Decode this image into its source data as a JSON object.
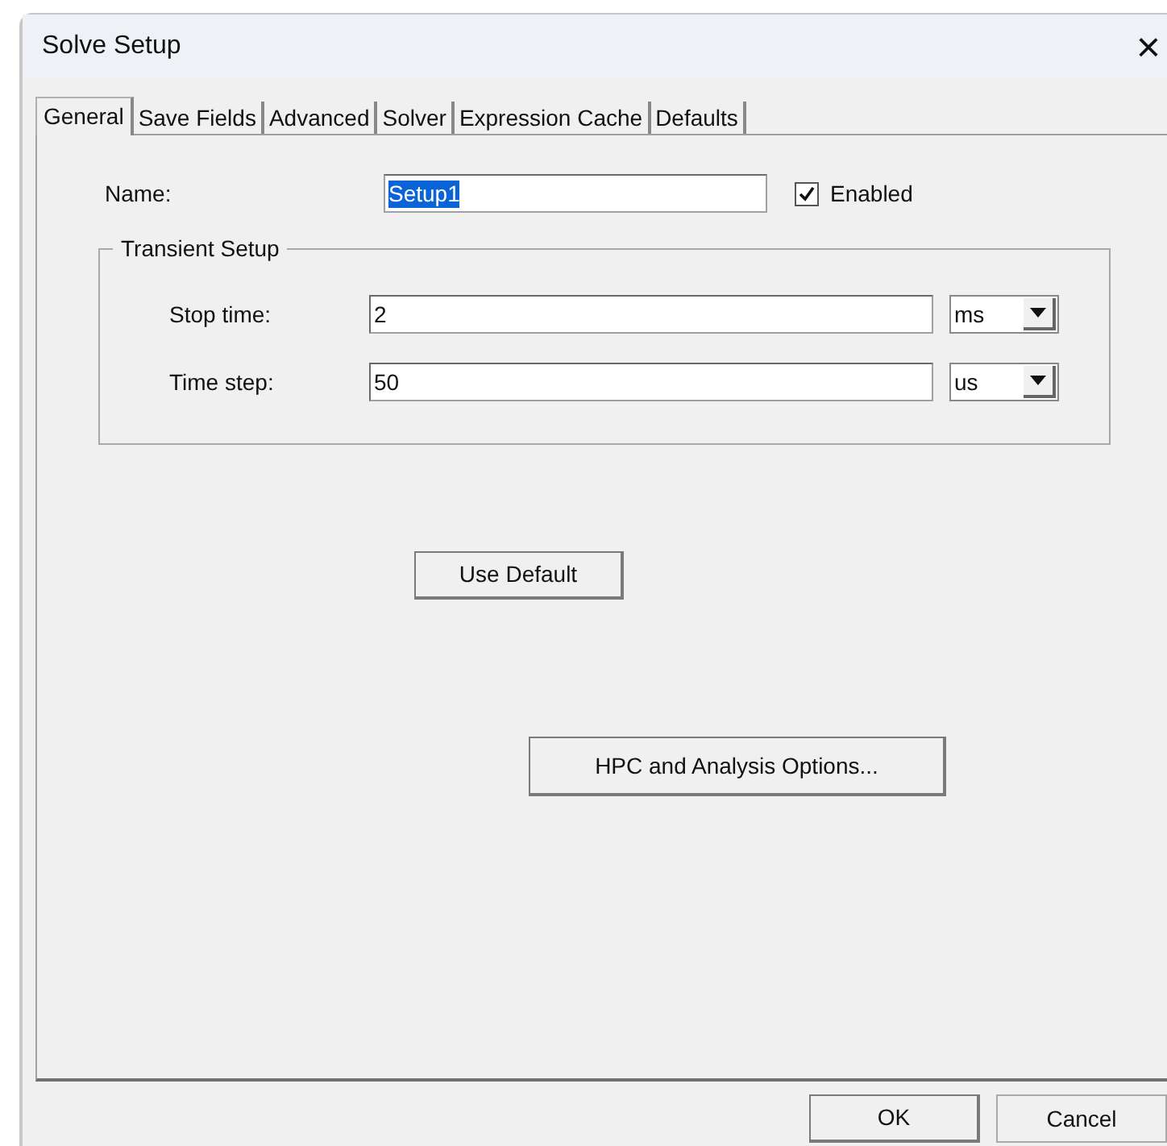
{
  "window": {
    "title": "Solve Setup",
    "close": "×"
  },
  "tabs": [
    {
      "label": "General",
      "selected": true
    },
    {
      "label": "Save Fields",
      "selected": false
    },
    {
      "label": "Advanced",
      "selected": false
    },
    {
      "label": "Solver",
      "selected": false
    },
    {
      "label": "Expression Cache",
      "selected": false
    },
    {
      "label": "Defaults",
      "selected": false
    }
  ],
  "name_row": {
    "label": "Name:",
    "value": "Setup1",
    "value_selected": true,
    "enabled": {
      "label": "Enabled",
      "checked": true
    }
  },
  "transient_setup": {
    "title": "Transient Setup",
    "rows": [
      {
        "label": "Stop time:",
        "value": "2",
        "unit": "ms"
      },
      {
        "label": "Time step:",
        "value": "50",
        "unit": "us"
      }
    ]
  },
  "use_default_button": "Use Default",
  "hpc_button": "HPC and Analysis Options...",
  "buttons": [
    "OK",
    "Cancel"
  ]
}
